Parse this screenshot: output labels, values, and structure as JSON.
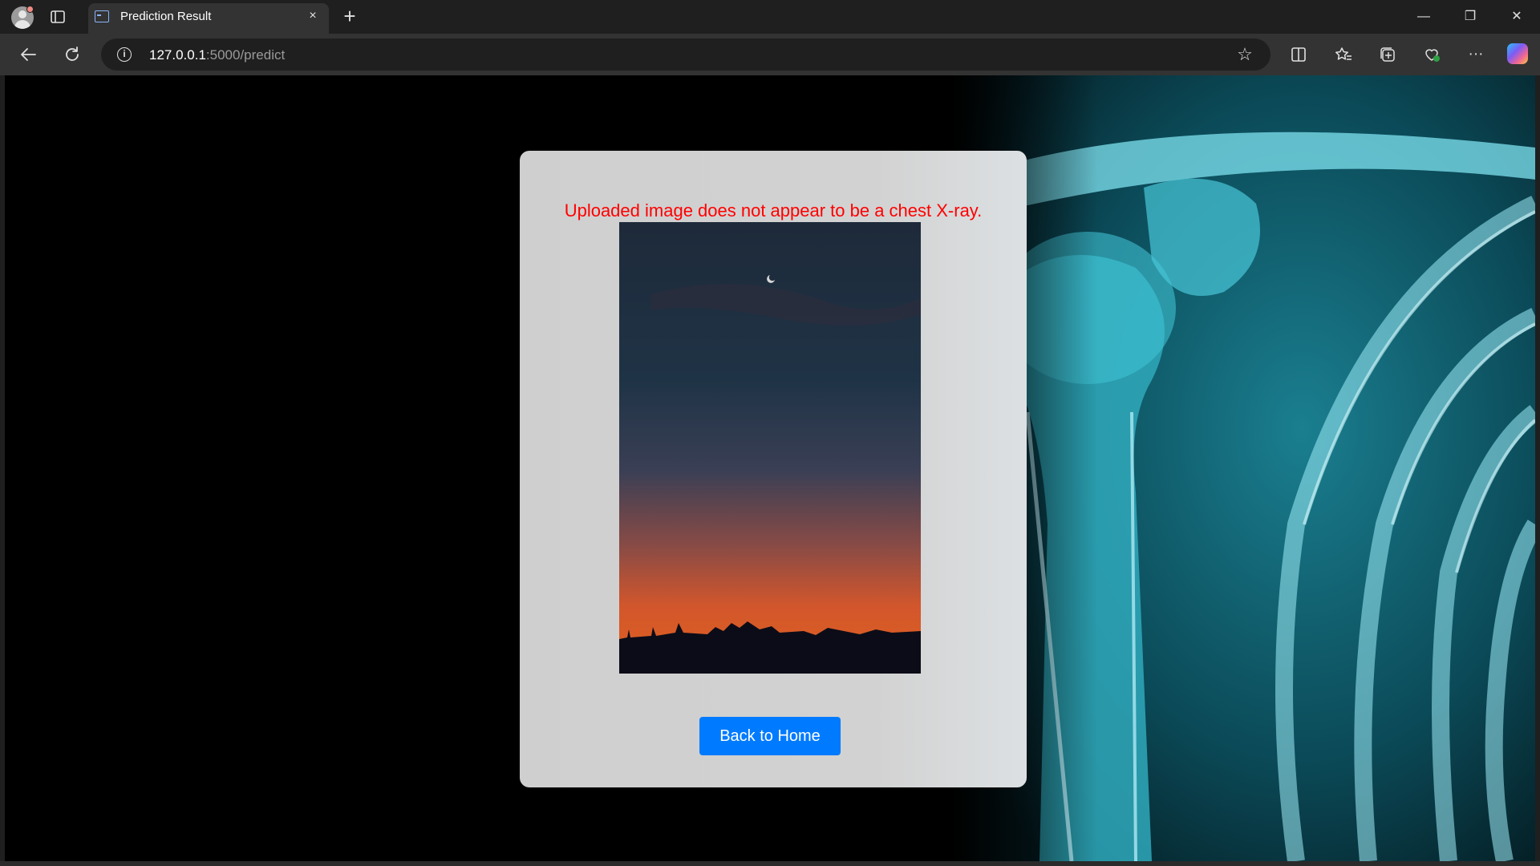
{
  "browser": {
    "tab_title": "Prediction Result",
    "tab_close_icon": "×",
    "new_tab_icon": "+",
    "url_host": "127.0.0.1",
    "url_path": ":5000/predict",
    "window_controls": {
      "minimize": "—",
      "restore": "❐",
      "close": "✕"
    },
    "icons": [
      "profile-icon",
      "tab-actions-icon",
      "back-icon",
      "refresh-icon",
      "info-icon",
      "favorite-star-icon",
      "split-screen-icon",
      "favorites-icon",
      "collections-icon",
      "browser-essentials-icon",
      "more-icon",
      "copilot-icon"
    ]
  },
  "page": {
    "error_message": "Uploaded image does not appear to be a chest X-ray.",
    "back_button_label": "Back to Home",
    "colors": {
      "error_text": "#ff0000",
      "button_bg": "#007bff",
      "card_bg": "#d0d0d0",
      "xray_tint": "#2bb3c8"
    }
  }
}
